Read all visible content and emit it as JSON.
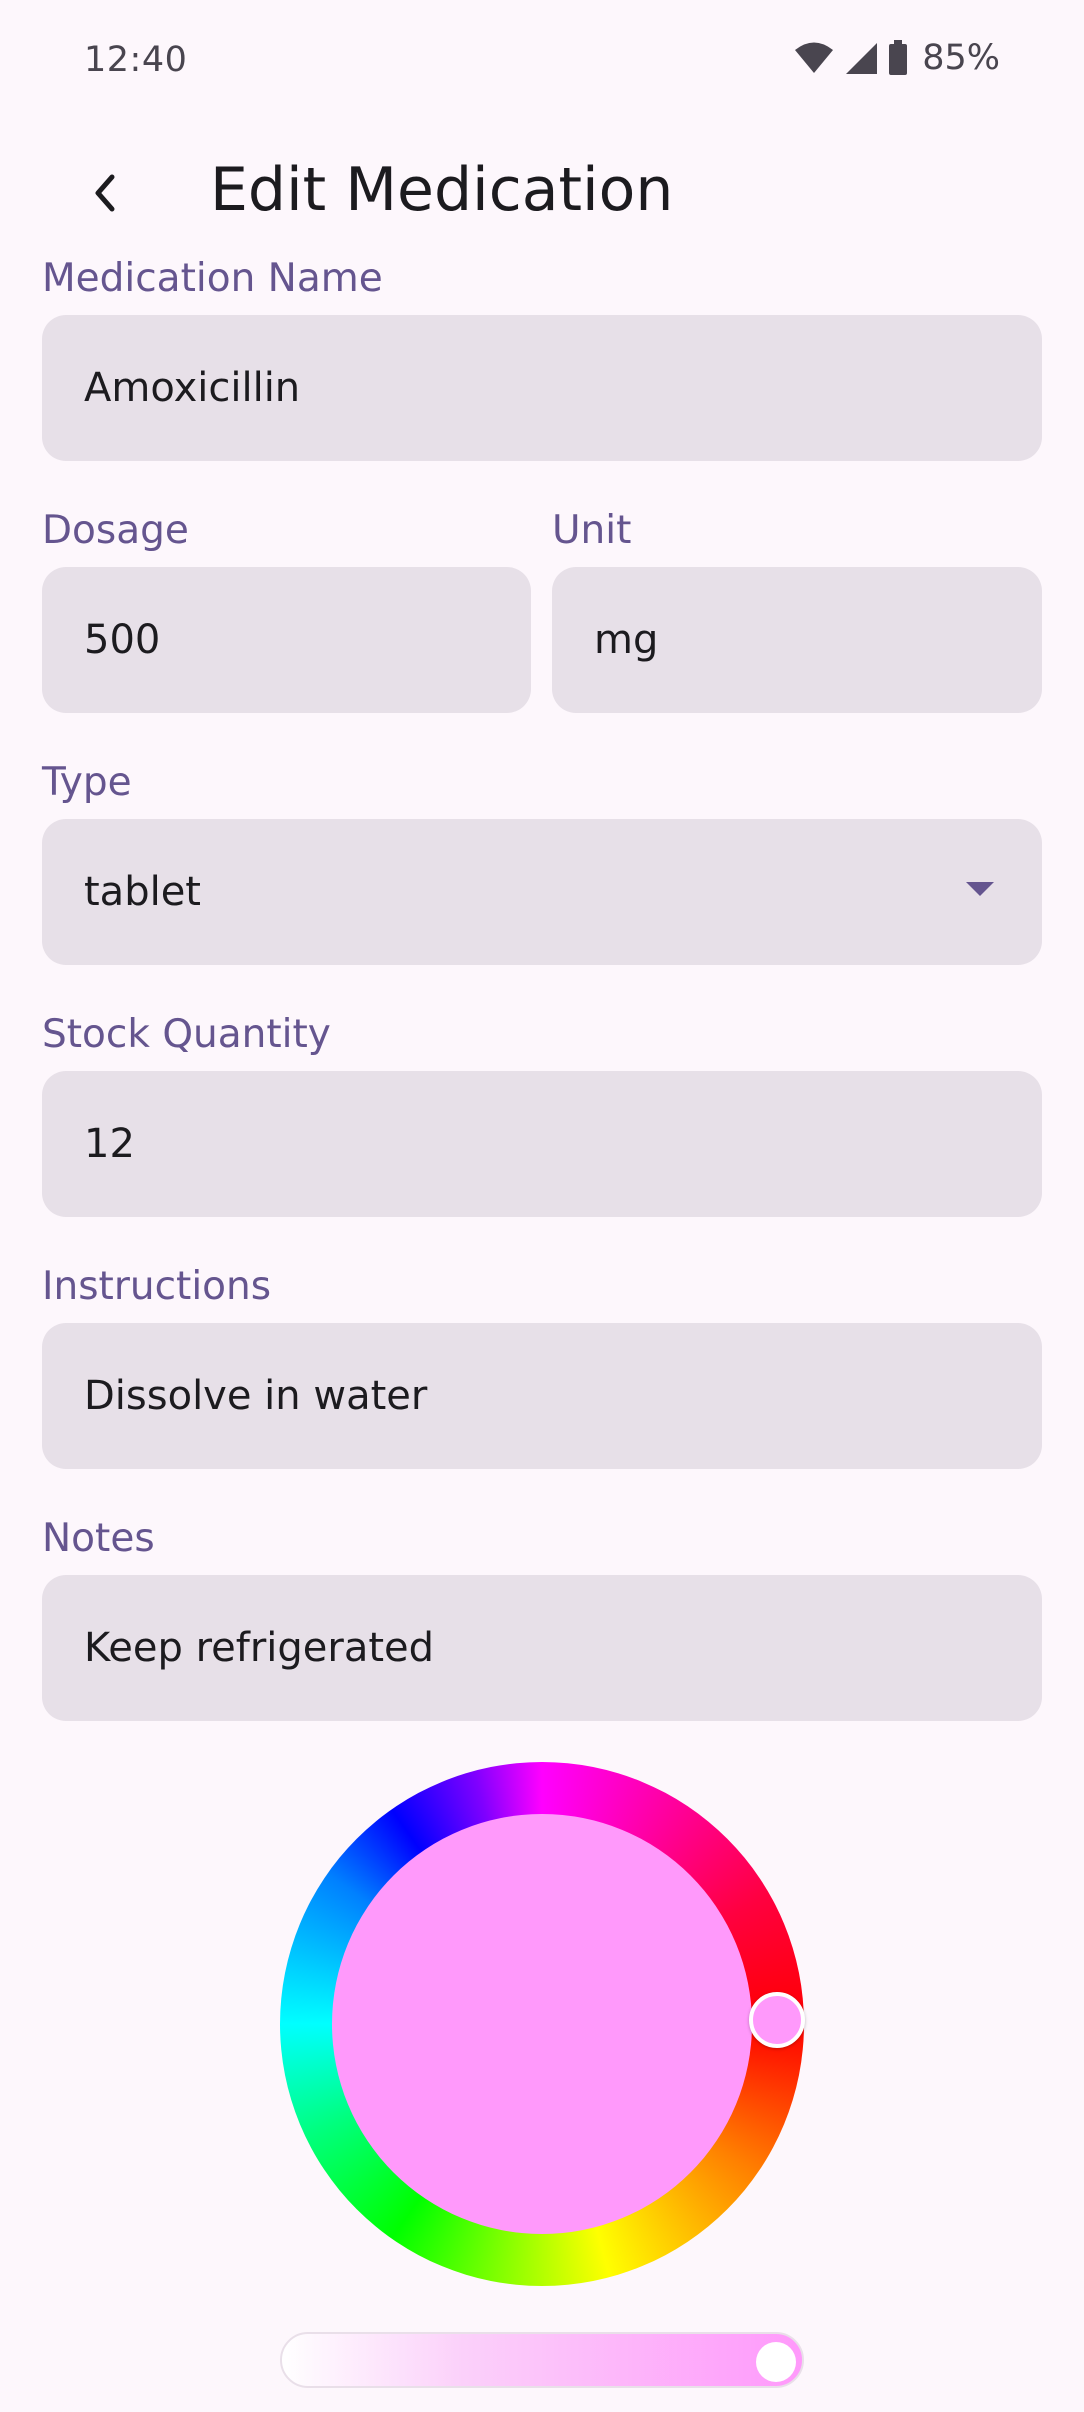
{
  "status_bar": {
    "time": "12:40",
    "battery": "85%",
    "icons": [
      "wifi-icon",
      "signal-icon",
      "battery-icon"
    ]
  },
  "app_bar": {
    "title": "Edit Medication",
    "back_icon": "chevron-left-icon"
  },
  "form": {
    "medication_name": {
      "label": "Medication Name",
      "value": "Amoxicillin"
    },
    "dosage": {
      "label": "Dosage",
      "value": "500"
    },
    "unit": {
      "label": "Unit",
      "value": "mg"
    },
    "type": {
      "label": "Type",
      "value": "tablet"
    },
    "stock_quantity": {
      "label": "Stock Quantity",
      "value": "12"
    },
    "instructions": {
      "label": "Instructions",
      "value": "Dissolve in water"
    },
    "notes": {
      "label": "Notes",
      "value": "Keep refrigerated"
    }
  },
  "color_picker": {
    "selected_color": "#ff99fb",
    "hue_handle_angle_deg": 90,
    "brightness": 0.95
  },
  "colors": {
    "background": "#fdf7fc",
    "field_bg": "#e7e0e8",
    "label": "#65558f",
    "text": "#1c1b1f"
  }
}
